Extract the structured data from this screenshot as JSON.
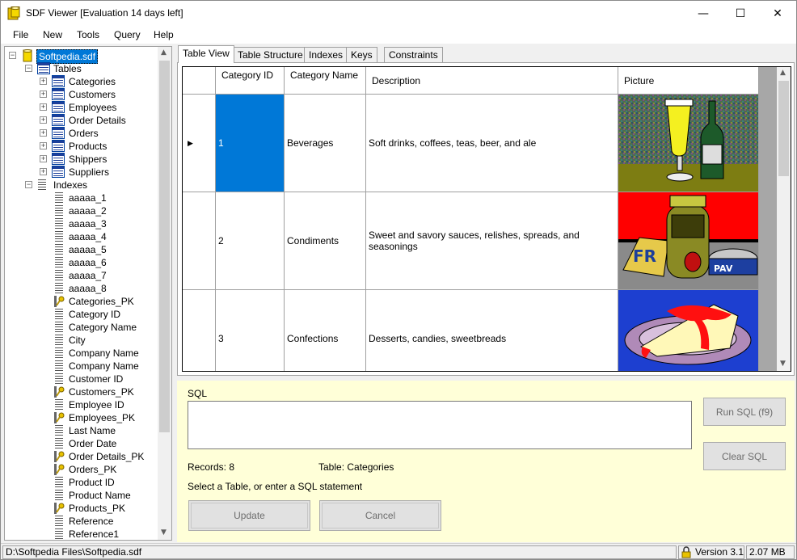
{
  "window": {
    "title": "SDF Viewer [Evaluation 14 days left]",
    "controls": {
      "minimize": "—",
      "maximize": "☐",
      "close": "✕"
    }
  },
  "menu": [
    "File",
    "New",
    "Tools",
    "Query",
    "Help"
  ],
  "tree": {
    "root": "Softpedia.sdf",
    "tables_label": "Tables",
    "tables": [
      "Categories",
      "Customers",
      "Employees",
      "Order Details",
      "Orders",
      "Products",
      "Shippers",
      "Suppliers"
    ],
    "indexes_label": "Indexes",
    "indexes": [
      {
        "name": "aaaaa_1",
        "icon": "index-icon"
      },
      {
        "name": "aaaaa_2",
        "icon": "index-icon"
      },
      {
        "name": "aaaaa_3",
        "icon": "index-icon"
      },
      {
        "name": "aaaaa_4",
        "icon": "index-icon"
      },
      {
        "name": "aaaaa_5",
        "icon": "index-icon"
      },
      {
        "name": "aaaaa_6",
        "icon": "index-icon"
      },
      {
        "name": "aaaaa_7",
        "icon": "index-icon"
      },
      {
        "name": "aaaaa_8",
        "icon": "index-icon"
      },
      {
        "name": "Categories_PK",
        "icon": "key-icon"
      },
      {
        "name": "Category ID",
        "icon": "index-icon"
      },
      {
        "name": "Category Name",
        "icon": "index-icon"
      },
      {
        "name": "City",
        "icon": "index-icon"
      },
      {
        "name": "Company Name",
        "icon": "index-icon"
      },
      {
        "name": "Company Name",
        "icon": "index-icon"
      },
      {
        "name": "Customer ID",
        "icon": "index-icon"
      },
      {
        "name": "Customers_PK",
        "icon": "key-icon"
      },
      {
        "name": "Employee ID",
        "icon": "index-icon"
      },
      {
        "name": "Employees_PK",
        "icon": "key-icon"
      },
      {
        "name": "Last Name",
        "icon": "index-icon"
      },
      {
        "name": "Order Date",
        "icon": "index-icon"
      },
      {
        "name": "Order Details_PK",
        "icon": "key-icon"
      },
      {
        "name": "Orders_PK",
        "icon": "key-icon"
      },
      {
        "name": "Product ID",
        "icon": "index-icon"
      },
      {
        "name": "Product Name",
        "icon": "index-icon"
      },
      {
        "name": "Products_PK",
        "icon": "key-icon"
      },
      {
        "name": "Reference",
        "icon": "index-icon"
      },
      {
        "name": "Reference1",
        "icon": "index-icon"
      }
    ]
  },
  "tabs": [
    "Table View",
    "Table Structure",
    "Indexes",
    "Keys",
    "Constraints"
  ],
  "active_tab": "Table View",
  "grid": {
    "columns": [
      "Category ID",
      "Category Name",
      "Description",
      "Picture"
    ],
    "rows": [
      {
        "id": "1",
        "name": "Beverages",
        "description": "Soft drinks, coffees, teas, beer, and ale",
        "picture": "beverages-picture"
      },
      {
        "id": "2",
        "name": "Condiments",
        "description": "Sweet and savory sauces, relishes, spreads, and seasonings",
        "picture": "condiments-picture"
      },
      {
        "id": "3",
        "name": "Confections",
        "description": "Desserts, candies, sweetbreads",
        "picture": "confections-picture"
      }
    ]
  },
  "sql": {
    "label": "SQL",
    "value": "",
    "run_button": "Run SQL (f9)",
    "clear_button": "Clear SQL",
    "records": "Records: 8",
    "table": "Table: Categories",
    "hint": "Select a Table, or enter a SQL statement",
    "update_button": "Update",
    "cancel_button": "Cancel"
  },
  "status": {
    "path": "D:\\Softpedia Files\\Softpedia.sdf",
    "version": "Version 3.1",
    "size": "2.07 MB"
  },
  "colors": {
    "selection": "#0078d7",
    "sql_panel": "#ffffd8"
  }
}
